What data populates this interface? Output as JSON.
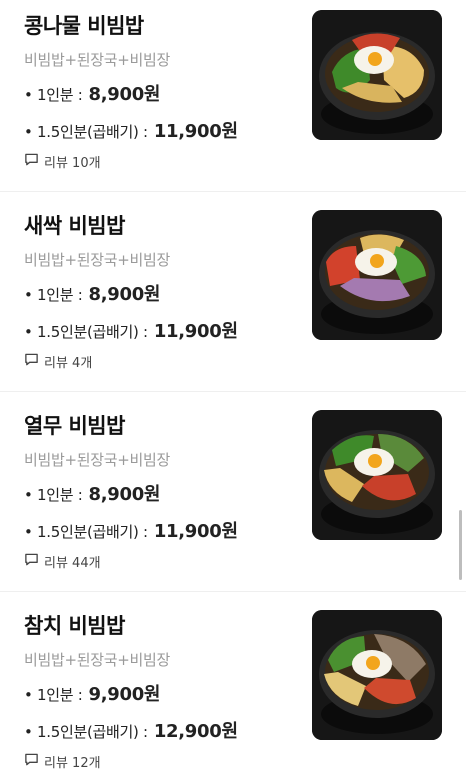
{
  "menu": [
    {
      "name": "콩나물 비빔밥",
      "description": "비빔밥+된장국+비빔장",
      "prices": [
        {
          "label": "• 1인분 :",
          "value": "8,900원"
        },
        {
          "label": "• 1.5인분(곱배기) :",
          "value": "11,900원"
        }
      ],
      "review": "리뷰 10개",
      "image": "bibimbap-photo"
    },
    {
      "name": "새싹 비빔밥",
      "description": "비빔밥+된장국+비빔장",
      "prices": [
        {
          "label": "• 1인분 :",
          "value": "8,900원"
        },
        {
          "label": "• 1.5인분(곱배기) :",
          "value": "11,900원"
        }
      ],
      "review": "리뷰 4개",
      "image": "bibimbap-photo"
    },
    {
      "name": "열무 비빔밥",
      "description": "비빔밥+된장국+비빔장",
      "prices": [
        {
          "label": "• 1인분 :",
          "value": "8,900원"
        },
        {
          "label": "• 1.5인분(곱배기) :",
          "value": "11,900원"
        }
      ],
      "review": "리뷰 44개",
      "image": "bibimbap-photo"
    },
    {
      "name": "참치 비빔밥",
      "description": "비빔밥+된장국+비빔장",
      "prices": [
        {
          "label": "• 1인분 :",
          "value": "9,900원"
        },
        {
          "label": "• 1.5인분(곱배기) :",
          "value": "12,900원"
        }
      ],
      "review": "리뷰 12개",
      "image": "bibimbap-photo"
    }
  ],
  "colors": {
    "text": "#111111",
    "description": "#9a9a9a",
    "divider": "#efefef"
  }
}
